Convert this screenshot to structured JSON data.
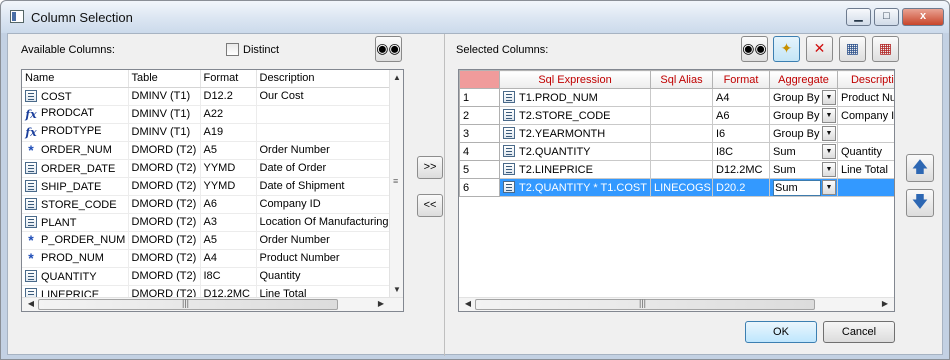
{
  "window": {
    "title": "Column Selection",
    "minimize": "▁",
    "maximize": "□",
    "close": "x"
  },
  "available": {
    "label": "Available Columns:",
    "distinct_label": "Distinct",
    "headers": [
      "Name",
      "Table",
      "Format",
      "Description"
    ],
    "rows": [
      {
        "icon": "column-icon",
        "name": "COST",
        "table": "DMINV (T1)",
        "format": "D12.2",
        "description": "Our Cost"
      },
      {
        "icon": "fx-icon",
        "name": "PRODCAT",
        "table": "DMINV (T1)",
        "format": "A22",
        "description": ""
      },
      {
        "icon": "fx-icon",
        "name": "PRODTYPE",
        "table": "DMINV (T1)",
        "format": "A19",
        "description": ""
      },
      {
        "icon": "key-icon",
        "name": "ORDER_NUM",
        "table": "DMORD (T2)",
        "format": "A5",
        "description": "Order Number"
      },
      {
        "icon": "column-icon",
        "name": "ORDER_DATE",
        "table": "DMORD (T2)",
        "format": "YYMD",
        "description": "Date of Order"
      },
      {
        "icon": "column-icon",
        "name": "SHIP_DATE",
        "table": "DMORD (T2)",
        "format": "YYMD",
        "description": "Date of Shipment"
      },
      {
        "icon": "column-icon",
        "name": "STORE_CODE",
        "table": "DMORD (T2)",
        "format": "A6",
        "description": "Company ID"
      },
      {
        "icon": "column-icon",
        "name": "PLANT",
        "table": "DMORD (T2)",
        "format": "A3",
        "description": "Location Of Manufacturing"
      },
      {
        "icon": "key-icon",
        "name": "P_ORDER_NUM",
        "table": "DMORD (T2)",
        "format": "A5",
        "description": "Order Number"
      },
      {
        "icon": "key-icon",
        "name": "PROD_NUM",
        "table": "DMORD (T2)",
        "format": "A4",
        "description": "Product Number"
      },
      {
        "icon": "column-icon",
        "name": "QUANTITY",
        "table": "DMORD (T2)",
        "format": "I8C",
        "description": "Quantity"
      },
      {
        "icon": "column-icon",
        "name": "LINEPRICE",
        "table": "DMORD (T2)",
        "format": "D12.2MC",
        "description": "Line Total"
      }
    ]
  },
  "move": {
    "add": ">>",
    "remove": "<<"
  },
  "selected": {
    "label": "Selected Columns:",
    "headers": [
      "",
      "Sql Expression",
      "Sql Alias",
      "Format",
      "Aggregate",
      "Description"
    ],
    "rows": [
      {
        "num": "1",
        "expr": "T1.PROD_NUM",
        "alias": "",
        "format": "A4",
        "aggregate": "Group By",
        "description": "Product Nu"
      },
      {
        "num": "2",
        "expr": "T2.STORE_CODE",
        "alias": "",
        "format": "A6",
        "aggregate": "Group By",
        "description": "Company ID"
      },
      {
        "num": "3",
        "expr": "T2.YEARMONTH",
        "alias": "",
        "format": "I6",
        "aggregate": "Group By",
        "description": ""
      },
      {
        "num": "4",
        "expr": "T2.QUANTITY",
        "alias": "",
        "format": "I8C",
        "aggregate": "Sum",
        "description": "Quantity"
      },
      {
        "num": "5",
        "expr": "T2.LINEPRICE",
        "alias": "",
        "format": "D12.2MC",
        "aggregate": "Sum",
        "description": "Line Total"
      },
      {
        "num": "6",
        "expr": "T2.QUANTITY * T1.COST",
        "alias": "LINECOGS",
        "format": "D20.2",
        "aggregate": "Sum",
        "description": ""
      }
    ],
    "selected_row": 6
  },
  "buttons": {
    "ok": "OK",
    "cancel": "Cancel"
  },
  "colors": {
    "selection": "#3399ff",
    "header_text": "#c00000",
    "corner": "#f09b9b"
  }
}
